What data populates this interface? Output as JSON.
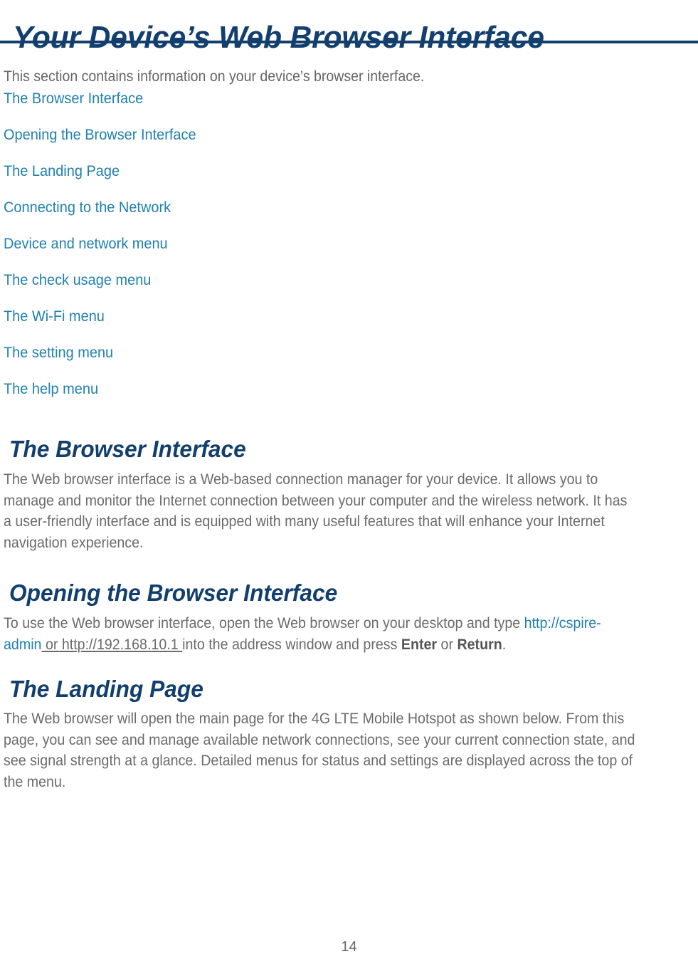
{
  "document": {
    "title": "Your Device’s Web Browser Interface",
    "intro": "This section contains information on your device’s browser interface.",
    "page_number": "14",
    "colors": {
      "heading_navy": "#123f6d",
      "link_blue": "#2080b0",
      "body_gray": "#6b6b6b",
      "rule": "#123f6d"
    }
  },
  "toc": {
    "items": [
      {
        "label": "The Browser Interface"
      },
      {
        "label": "Opening the Browser Interface"
      },
      {
        "label": "The Landing Page"
      },
      {
        "label": "Connecting to the Network"
      },
      {
        "label": "Device and network menu"
      },
      {
        "label": "The check usage menu"
      },
      {
        "label": "The Wi-Fi menu"
      },
      {
        "label": "The setting menu"
      },
      {
        "label": "The help menu"
      }
    ]
  },
  "sections": [
    {
      "heading": "The Browser Interface",
      "body": "The Web browser interface is a Web-based connection manager for your device. It allows you to manage and monitor the Internet connection between your computer and the wireless network. It has a user-friendly interface and is equipped with many useful features that will enhance your Internet navigation experience."
    },
    {
      "heading": "Opening the Browser Interface",
      "body_parts": {
        "lead": "To use the Web browser interface, open the Web browser on your desktop and type ",
        "url_primary": "http://cspire-admin",
        "url_alternate": " or http://192.168.10.1 ",
        "middle": "into the address window and press ",
        "key_enter": "Enter",
        "conjunction": " or ",
        "key_return": "Return",
        "tail": "."
      }
    },
    {
      "heading": "The Landing Page",
      "body": "The Web browser will open the main page for the 4G LTE Mobile Hotspot as shown below. From this page, you can see and manage available network connections, see your current connection state, and see signal strength at a glance. Detailed menus for status and settings are displayed across the top of the menu."
    }
  ]
}
